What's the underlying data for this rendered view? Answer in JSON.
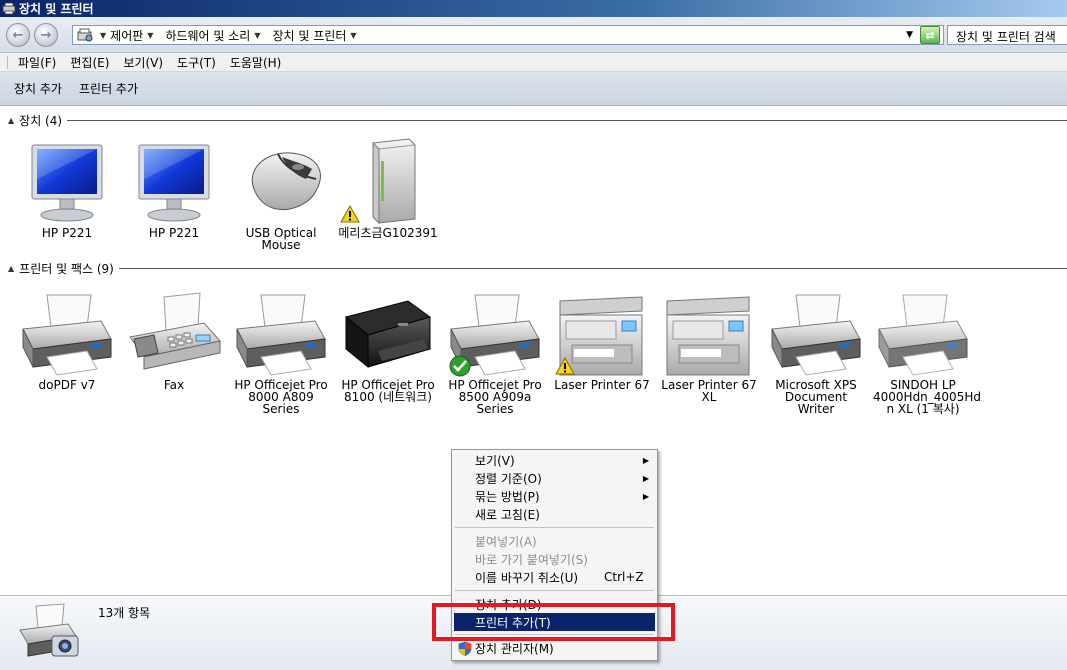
{
  "window": {
    "title": "장치 및 프린터"
  },
  "address": {
    "crumbs": [
      "제어판",
      "하드웨어 및 소리",
      "장치 및 프린터"
    ],
    "search_placeholder": "장치 및 프린터 검색"
  },
  "menubar": [
    "파일(F)",
    "편집(E)",
    "보기(V)",
    "도구(T)",
    "도움말(H)"
  ],
  "commands": {
    "add_device": "장치 추가",
    "add_printer": "프린터 추가"
  },
  "groups": {
    "devices": {
      "title": "장치 (4)"
    },
    "printers": {
      "title": "프린터 및 팩스 (9)"
    }
  },
  "devices": [
    {
      "label": "HP P221",
      "icon": "monitor-icon"
    },
    {
      "label": "HP P221",
      "icon": "monitor-icon"
    },
    {
      "label": "USB Optical\nMouse",
      "icon": "mouse-icon"
    },
    {
      "label": "메리츠금G102391",
      "icon": "computer-tower-icon",
      "warning": true
    }
  ],
  "printers": [
    {
      "label": "doPDF v7"
    },
    {
      "label": "Fax"
    },
    {
      "label": "HP Officejet Pro\n8000 A809\nSeries"
    },
    {
      "label": "HP Officejet Pro\n8100 (네트워크)"
    },
    {
      "label": "HP Officejet Pro\n8500 A909a\nSeries",
      "default": true
    },
    {
      "label": "Laser Printer 67",
      "warning": true
    },
    {
      "label": "Laser Printer 67\nXL"
    },
    {
      "label": "Microsoft XPS\nDocument Writer"
    },
    {
      "label": "SINDOH LP\n4000Hdn_4005Hd\nn XL (1 복사)"
    }
  ],
  "details": {
    "count": "13개 항목"
  },
  "context_menu": {
    "view": "보기(V)",
    "sort": "정렬 기준(O)",
    "group": "묶는 방법(P)",
    "refresh": "새로 고침(E)",
    "paste": "붙여넣기(A)",
    "paste_shortcut": "바로 가기 붙여넣기(S)",
    "undo_rename": "이름 바꾸기 취소(U)",
    "undo_shortcut": "Ctrl+Z",
    "add_device": "장치 추가(D)",
    "add_printer": "프린터 추가(T)",
    "device_manager": "장치 관리자(M)"
  },
  "colors": {
    "highlight": "#0a246a",
    "callout": "#e41820"
  }
}
